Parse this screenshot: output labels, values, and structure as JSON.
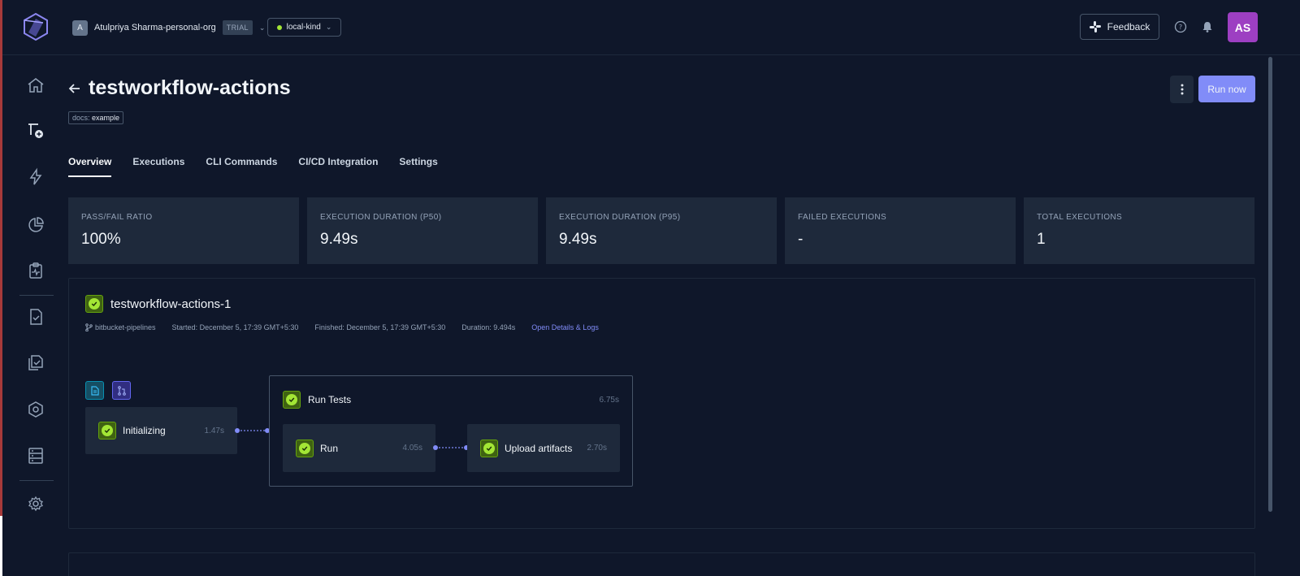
{
  "org": {
    "initial": "A",
    "name": "Atulpriya Sharma-personal-org",
    "badge": "TRIAL"
  },
  "environment": {
    "name": "local-kind"
  },
  "header": {
    "feedback_label": "Feedback",
    "user_initials": "AS"
  },
  "page": {
    "title": "testworkflow-actions",
    "label_key": "docs:",
    "label_value": "example",
    "run_now_label": "Run now"
  },
  "tabs": [
    "Overview",
    "Executions",
    "CLI Commands",
    "CI/CD Integration",
    "Settings"
  ],
  "stats": [
    {
      "label": "PASS/FAIL RATIO",
      "value": "100%"
    },
    {
      "label": "EXECUTION DURATION (P50)",
      "value": "9.49s"
    },
    {
      "label": "EXECUTION DURATION (P95)",
      "value": "9.49s"
    },
    {
      "label": "FAILED EXECUTIONS",
      "value": "-"
    },
    {
      "label": "TOTAL EXECUTIONS",
      "value": "1"
    }
  ],
  "execution": {
    "name": "testworkflow-actions-1",
    "branch": "bitbucket-pipelines",
    "started": "Started: December 5, 17:39 GMT+5:30",
    "finished": "Finished: December 5, 17:39 GMT+5:30",
    "duration": "Duration: 9.494s",
    "details_link": "Open Details & Logs",
    "steps": {
      "init": {
        "name": "Initializing",
        "time": "1.47s"
      },
      "group": {
        "name": "Run Tests",
        "time": "6.75s"
      },
      "run": {
        "name": "Run",
        "time": "4.05s"
      },
      "upload": {
        "name": "Upload artifacts",
        "time": "2.70s"
      }
    }
  },
  "colors": {
    "accent": "#818cf8",
    "success": "#a3e635",
    "avatar": "#9d3fc2"
  }
}
